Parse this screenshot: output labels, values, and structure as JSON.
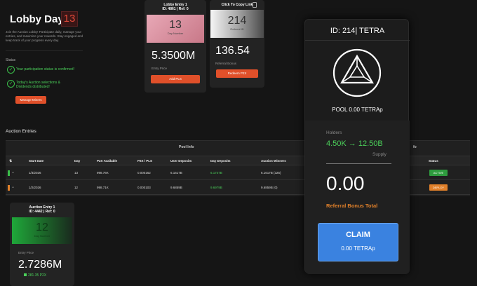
{
  "header": {
    "title": "Lobby Day",
    "day_number": "13",
    "intro": "Join the Auction Lobby! Participate daily, manage your entries, and maximize your rewards. Stay engaged and keep track of your progress every day.",
    "status_label": "Status",
    "status_items": [
      "Your participation status is confirmed!",
      "Today's Auction selections & Dividends distributed!"
    ],
    "manage_button": "Manage Miners"
  },
  "lobby_entry": {
    "title": "Lobby Entry 1",
    "id_line": "ID: 4861 | Ref: 0",
    "day_number": "13",
    "day_label": "Day Number",
    "value": "5.3500M",
    "value_label": "Entry Price",
    "button": "Add PLS"
  },
  "referral_card": {
    "title": "Click To Copy Link",
    "number": "214",
    "number_label": "Referral ID",
    "value": "136.54",
    "value_label": "Referral Bonus",
    "button": "Redeem P2X"
  },
  "auction": {
    "title": "Auction Entries",
    "pool_info": "Pool Info",
    "info_right": "fo",
    "columns": [
      "Start Date",
      "Day",
      "P2X Available",
      "P2X / PLS",
      "User Deposits",
      "Day Deposits",
      "Auction Winners",
      "Status"
    ],
    "rows": [
      {
        "start": "1/3/2026",
        "day": "13",
        "available": "998.76K",
        "ratio": "0.000162",
        "user": "6.1617B",
        "deposits": "6.1747B",
        "winners": "6.1617B (325)",
        "status": "ACTIVE"
      },
      {
        "start": "1/2/2026",
        "day": "12",
        "available": "998.71K",
        "ratio": "0.000103",
        "user": "9.6859B",
        "deposits": "9.6979B",
        "winners": "9.6859B (0)",
        "status": "DEPLOY"
      }
    ]
  },
  "auction_entry": {
    "title": "Auction Entry 1",
    "id_line": "ID: 4442 | Ref: 0",
    "day_number": "12",
    "day_label": "Day Number",
    "value_label": "Entry Price",
    "value": "2.7286M",
    "sub_value": "281.35 P2X"
  },
  "overlay": {
    "id_title": "ID: 214| TETRA",
    "pool": "POOL 0.00 TETRAp",
    "holders_label": "Holders",
    "holders": "4.50K → 12.50B",
    "supply_label": "Supply",
    "amount": "0.00",
    "referral_label": "Referral Bonus Total",
    "claim_label": "CLAIM",
    "claim_amount": "0.00  TETRAp"
  },
  "colors": {
    "accent_orange": "#e0502a",
    "success_green": "#4bd15a",
    "claim_blue": "#3a82e0"
  }
}
